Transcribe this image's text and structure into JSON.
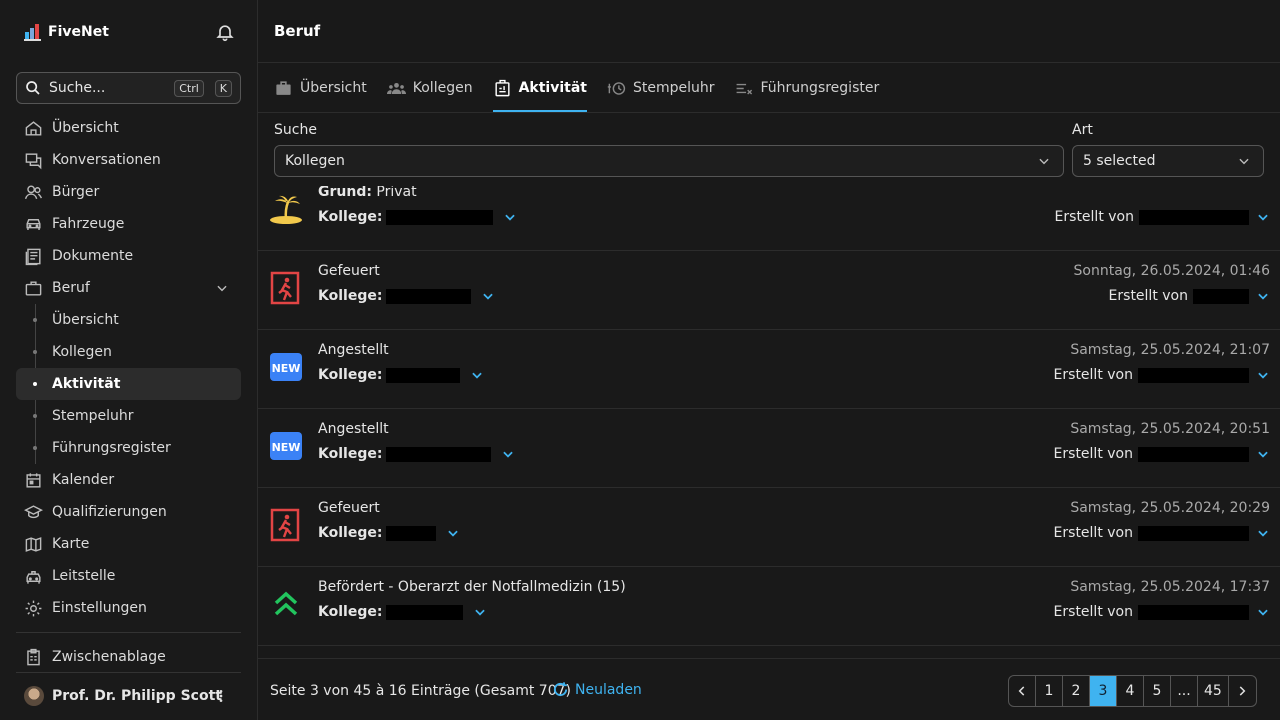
{
  "app": {
    "name": "FiveNet"
  },
  "search": {
    "label": "Suche...",
    "kbd1": "Ctrl",
    "kbd2": "K"
  },
  "sidebar": {
    "items": [
      {
        "label": "Übersicht"
      },
      {
        "label": "Konversationen"
      },
      {
        "label": "Bürger"
      },
      {
        "label": "Fahrzeuge"
      },
      {
        "label": "Dokumente"
      },
      {
        "label": "Beruf"
      }
    ],
    "beruf_sub": [
      {
        "label": "Übersicht"
      },
      {
        "label": "Kollegen"
      },
      {
        "label": "Aktivität"
      },
      {
        "label": "Stempeluhr"
      },
      {
        "label": "Führungsregister"
      }
    ],
    "items2": [
      {
        "label": "Kalender"
      },
      {
        "label": "Qualifizierungen"
      },
      {
        "label": "Karte"
      },
      {
        "label": "Leitstelle"
      },
      {
        "label": "Einstellungen"
      }
    ],
    "clipboard": "Zwischenablage",
    "user": "Prof. Dr. Philipp Scott"
  },
  "page": {
    "title": "Beruf"
  },
  "tabs": [
    {
      "label": "Übersicht"
    },
    {
      "label": "Kollegen"
    },
    {
      "label": "Aktivität"
    },
    {
      "label": "Stempeluhr"
    },
    {
      "label": "Führungsregister"
    }
  ],
  "filters": {
    "search_label": "Suche",
    "search_value": "Kollegen",
    "type_label": "Art",
    "type_value": "5 selected"
  },
  "activity": {
    "colleague_label": "Kollege:",
    "created_by_label": "Erstellt von",
    "rows": [
      {
        "icon": "island-icon",
        "reason_label": "Grund:",
        "title": "Privat",
        "date": ""
      },
      {
        "icon": "exit-icon",
        "title": "Gefeuert",
        "date": "Sonntag, 26.05.2024, 01:46"
      },
      {
        "icon": "new-icon",
        "title": "Angestellt",
        "date": "Samstag, 25.05.2024, 21:07"
      },
      {
        "icon": "new-icon",
        "title": "Angestellt",
        "date": "Samstag, 25.05.2024, 20:51"
      },
      {
        "icon": "exit-icon",
        "title": "Gefeuert",
        "date": "Samstag, 25.05.2024, 20:29"
      },
      {
        "icon": "chevron-double-up-icon",
        "title": "Befördert - Oberarzt der Notfallmedizin (15)",
        "date": "Samstag, 25.05.2024, 17:37"
      }
    ],
    "new_badge": "NEW"
  },
  "footer": {
    "page_info": "Seite 3 von 45 à 16 Einträge (Gesamt 707)",
    "reload": "Neuladen",
    "pages": [
      "1",
      "2",
      "3",
      "4",
      "5",
      "...",
      "45"
    ]
  },
  "colors": {
    "accent": "#3fb3f0",
    "danger": "#e24545",
    "success": "#22c55e",
    "new_badge": "#3b82f6"
  }
}
